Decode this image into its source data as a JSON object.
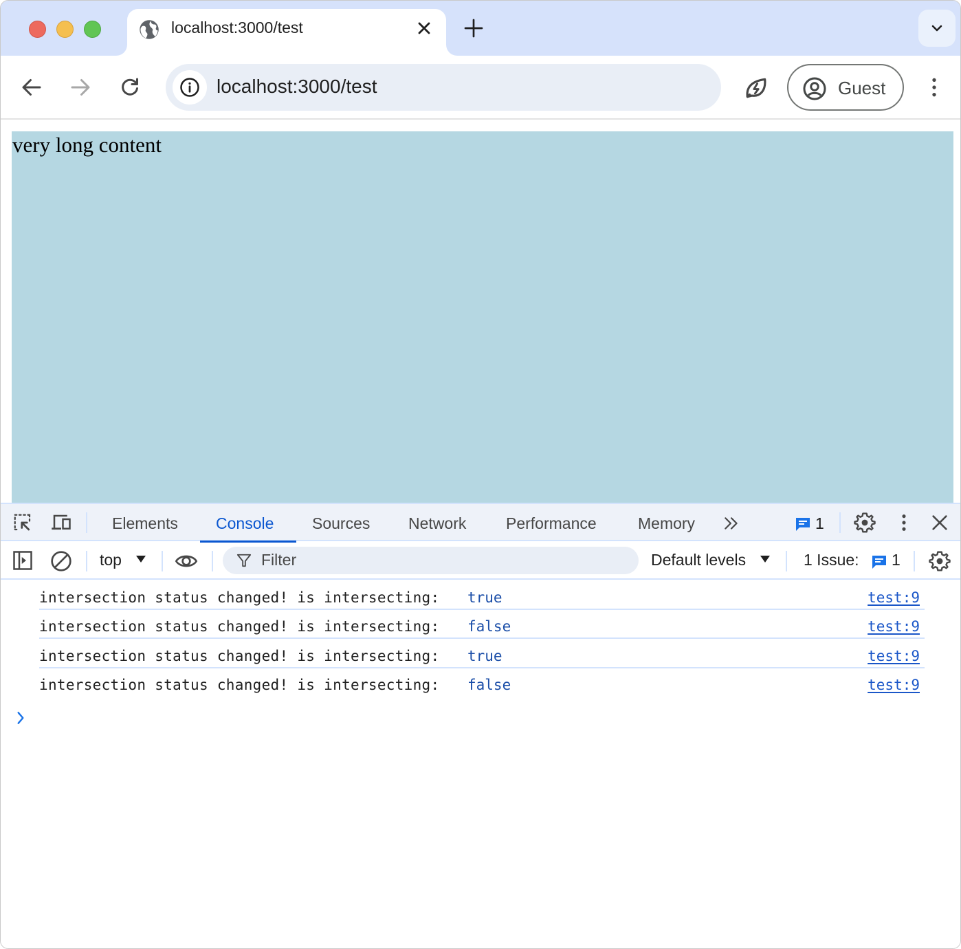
{
  "browser": {
    "tab": {
      "title": "localhost:3000/test",
      "icon": "globe-icon"
    },
    "omnibox": {
      "url": "localhost:3000/test"
    },
    "profile": {
      "label": "Guest"
    }
  },
  "page": {
    "content_text": "very long content",
    "content_bg": "#b5d7e2"
  },
  "devtools": {
    "tabs": [
      {
        "label": "Elements",
        "active": false
      },
      {
        "label": "Console",
        "active": true
      },
      {
        "label": "Sources",
        "active": false
      },
      {
        "label": "Network",
        "active": false
      },
      {
        "label": "Performance",
        "active": false
      },
      {
        "label": "Memory",
        "active": false
      }
    ],
    "issues_badge_count": "1",
    "console_toolbar": {
      "context": "top",
      "filter_placeholder": "Filter",
      "levels": "Default levels",
      "issues_label": "1 Issue:",
      "issues_count": "1"
    },
    "messages": [
      {
        "text": "intersection status changed! is intersecting:",
        "value": "true",
        "source": "test:9"
      },
      {
        "text": "intersection status changed! is intersecting:",
        "value": "false",
        "source": "test:9"
      },
      {
        "text": "intersection status changed! is intersecting:",
        "value": "true",
        "source": "test:9"
      },
      {
        "text": "intersection status changed! is intersecting:",
        "value": "false",
        "source": "test:9"
      }
    ],
    "accent_color": "#0b57d0"
  }
}
